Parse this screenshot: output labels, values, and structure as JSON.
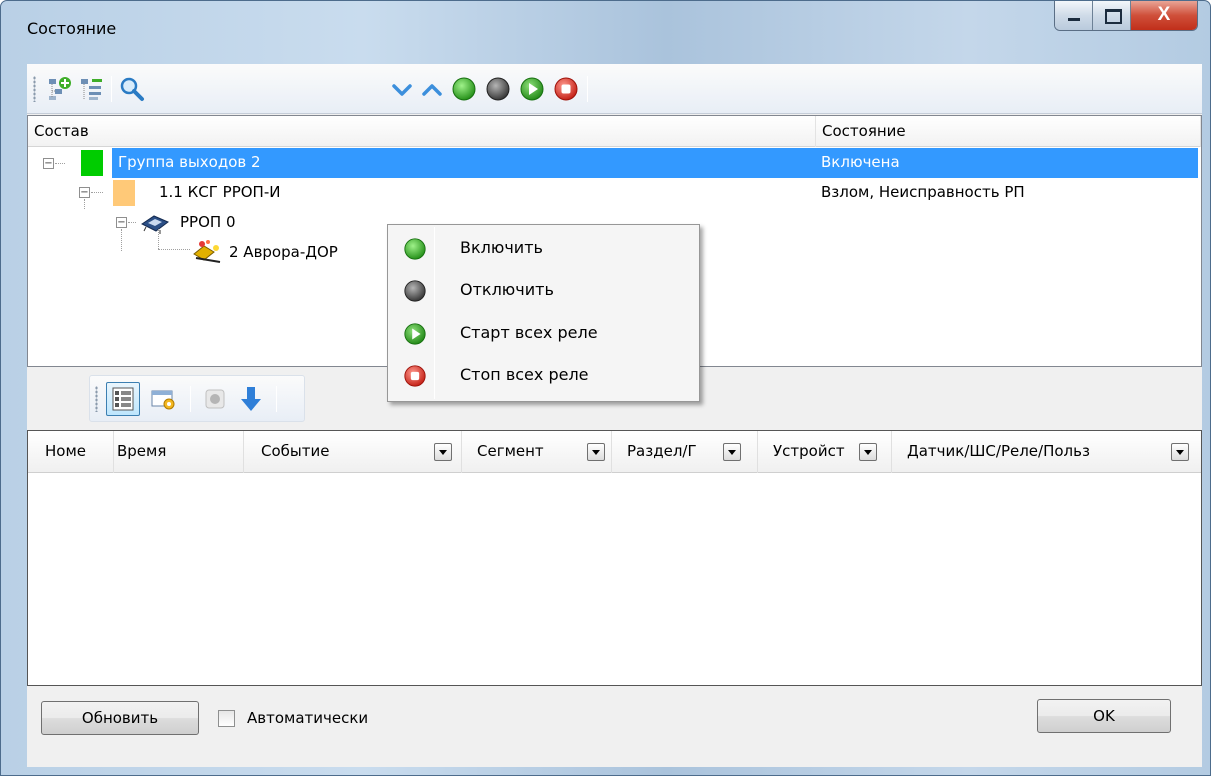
{
  "window": {
    "title": "Состояние",
    "close_glyph": "X"
  },
  "toolbar": {
    "icons": [
      "tree-add-icon",
      "tree-collapse-icon",
      "search-icon",
      "chevron-down-icon",
      "chevron-up-icon",
      "green-circle-icon",
      "gray-circle-icon",
      "play-circle-icon",
      "stop-circle-icon"
    ]
  },
  "tree": {
    "columns": {
      "name": "Состав",
      "state": "Состояние"
    },
    "rows": [
      {
        "name": "Группа выходов 2",
        "state": "Включена",
        "selected": true
      },
      {
        "name": "1.1 КСГ РРОП-И",
        "state": "Взлом, Неисправность РП"
      },
      {
        "name": "РРОП 0",
        "state": ""
      },
      {
        "name": "2 Аврора-ДОР",
        "state": ""
      }
    ]
  },
  "context_menu": {
    "items": [
      {
        "label": "Включить",
        "icon": "green-circle-icon"
      },
      {
        "label": "Отключить",
        "icon": "gray-circle-icon"
      },
      {
        "label": "Старт всех реле",
        "icon": "play-circle-icon"
      },
      {
        "label": "Стоп всех реле",
        "icon": "stop-circle-icon"
      }
    ]
  },
  "events_toolbar": {
    "icons": [
      "list-view-icon",
      "settings-window-icon",
      "disabled-record-icon",
      "arrow-down-icon"
    ]
  },
  "events_grid": {
    "columns": [
      "Номе",
      "Время",
      "Событие",
      "Сегмент",
      "Раздел/Г",
      "Устройст",
      "Датчик/ШС/Реле/Польз"
    ]
  },
  "footer": {
    "refresh_label": "Обновить",
    "auto_label": "Автоматически",
    "auto_checked": false,
    "ok_label": "OK"
  },
  "colors": {
    "selection": "#3399ff",
    "group_square": "#00cc00",
    "device_square": "#ffc978"
  }
}
